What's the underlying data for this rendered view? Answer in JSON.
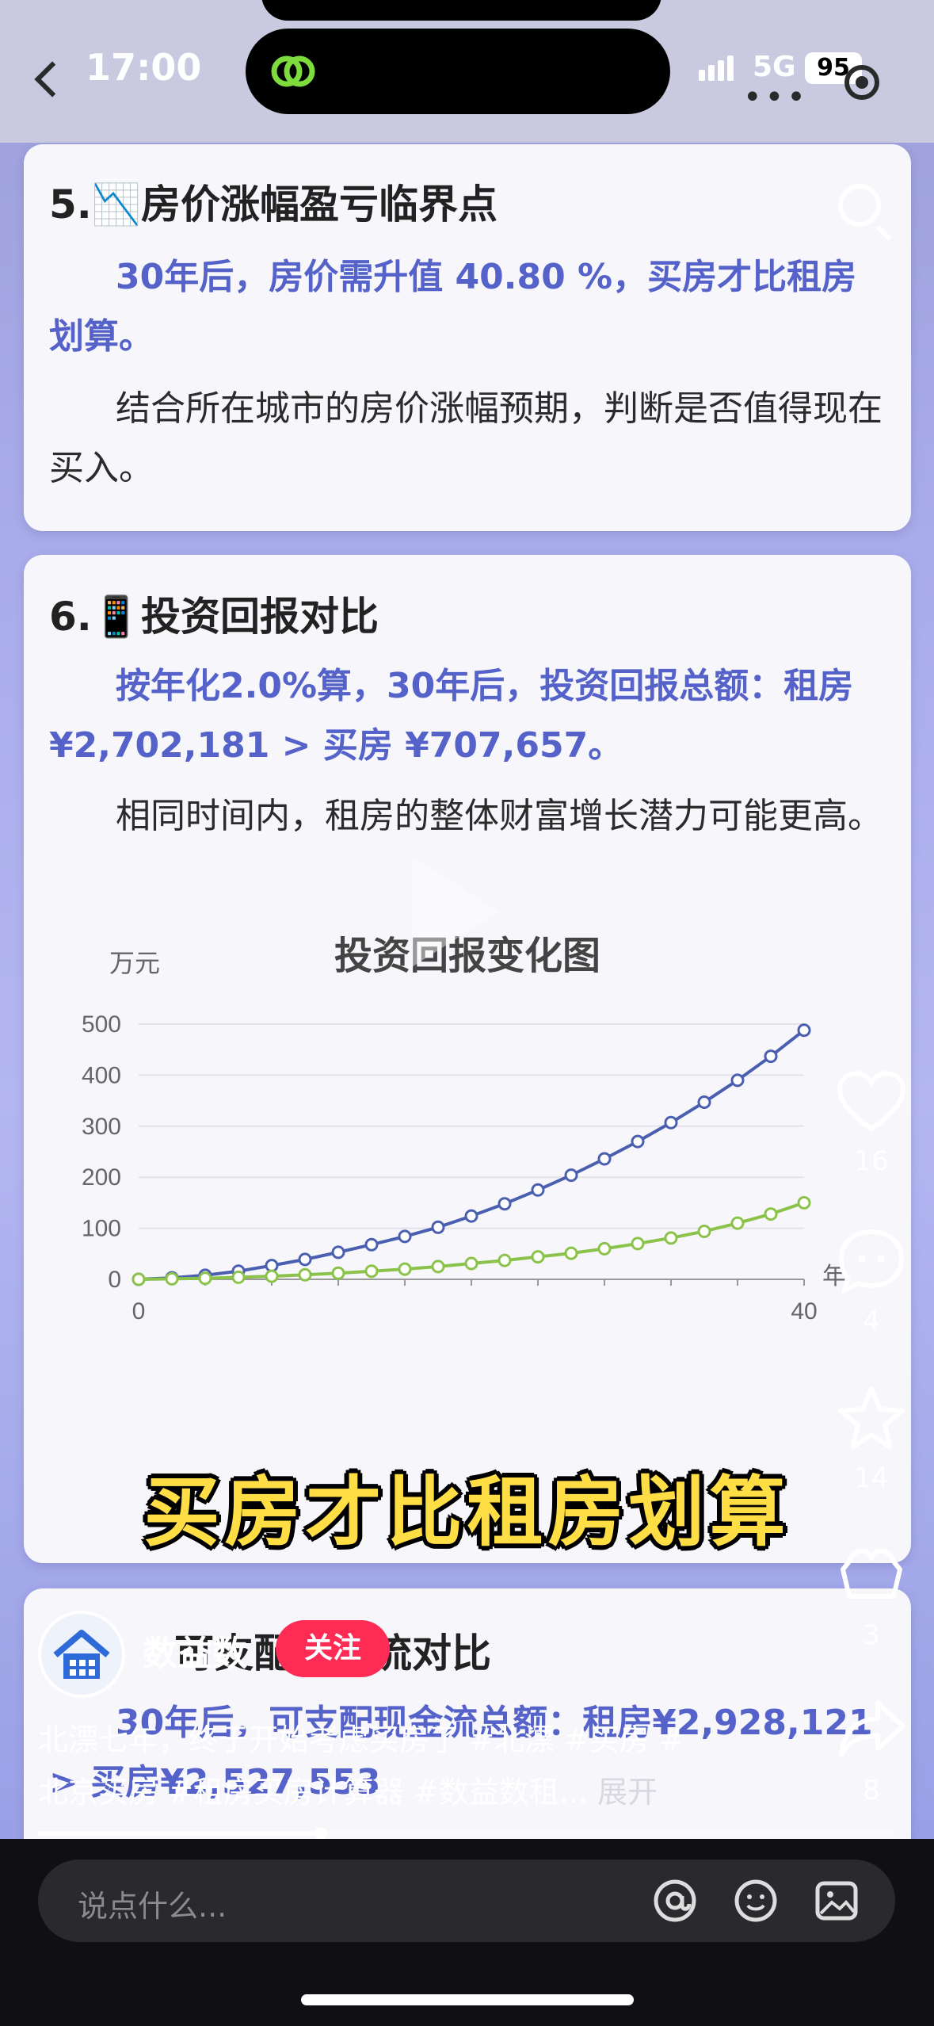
{
  "status_bar": {
    "time": "17:00",
    "network": "5G",
    "battery": "95"
  },
  "cards": {
    "card5": {
      "title": "5.📉房价涨幅盈亏临界点",
      "highlight": "30年后，房价需升值 40.80 %，买房才比租房划算。",
      "body": "结合所在城市的房价涨幅预期，判断是否值得现在买入。"
    },
    "card6": {
      "title": "6.📱投资回报对比",
      "highlight": "按年化2.0%算，30年后，投资回报总额：租房 ¥2,702,181 > 买房 ¥707,657。",
      "body": "相同时间内，租房的整体财富增长潜力可能更高。"
    },
    "card7": {
      "title_fragment": "可支配现金流对比",
      "highlight_fragment": "30年后，可支配现金流总额：租房¥2,928,121 > 买房¥2,527,553"
    }
  },
  "chart_data": {
    "type": "line",
    "title": "投资回报变化图",
    "ylabel": "万元",
    "xlabel": "年",
    "ylim": [
      0,
      500
    ],
    "yticks": [
      0,
      100,
      200,
      300,
      400,
      500
    ],
    "xlim": [
      0,
      40
    ],
    "xticks": [
      0,
      40
    ],
    "x": [
      0,
      2,
      4,
      6,
      8,
      10,
      12,
      14,
      16,
      18,
      20,
      22,
      24,
      26,
      28,
      30,
      32,
      34,
      36,
      38,
      40
    ],
    "series": [
      {
        "color": "#4b5fb0",
        "values": [
          0,
          3,
          8,
          16,
          27,
          39,
          53,
          68,
          84,
          102,
          124,
          148,
          175,
          204,
          236,
          270,
          307,
          347,
          390,
          437,
          488
        ]
      },
      {
        "color": "#8bc34a",
        "values": [
          0,
          1,
          2,
          4,
          6,
          9,
          12,
          16,
          20,
          25,
          31,
          37,
          44,
          51,
          60,
          70,
          81,
          94,
          110,
          128,
          150
        ]
      }
    ],
    "grid": true
  },
  "subtitle": "买房才比租房划算",
  "actions": {
    "like_count": "16",
    "comment_count": "4",
    "favorite_count": "14",
    "share_count_a": "3",
    "share_count_b": "8"
  },
  "author": {
    "name": "数益数",
    "follow_label": "关注"
  },
  "caption": {
    "line1": "北漂七年，终于开始考虑买房了 #北漂 #买房 #",
    "line2": "北京买房 #租房买房计算器 #数益数租...",
    "more": "展开"
  },
  "progress": {
    "played_fraction": 0.33
  },
  "comment": {
    "placeholder": "说点什么..."
  },
  "colors": {
    "accent_blue": "#5462c9",
    "follow_red": "#fe2c55",
    "subtitle_yellow": "#ffde45"
  }
}
